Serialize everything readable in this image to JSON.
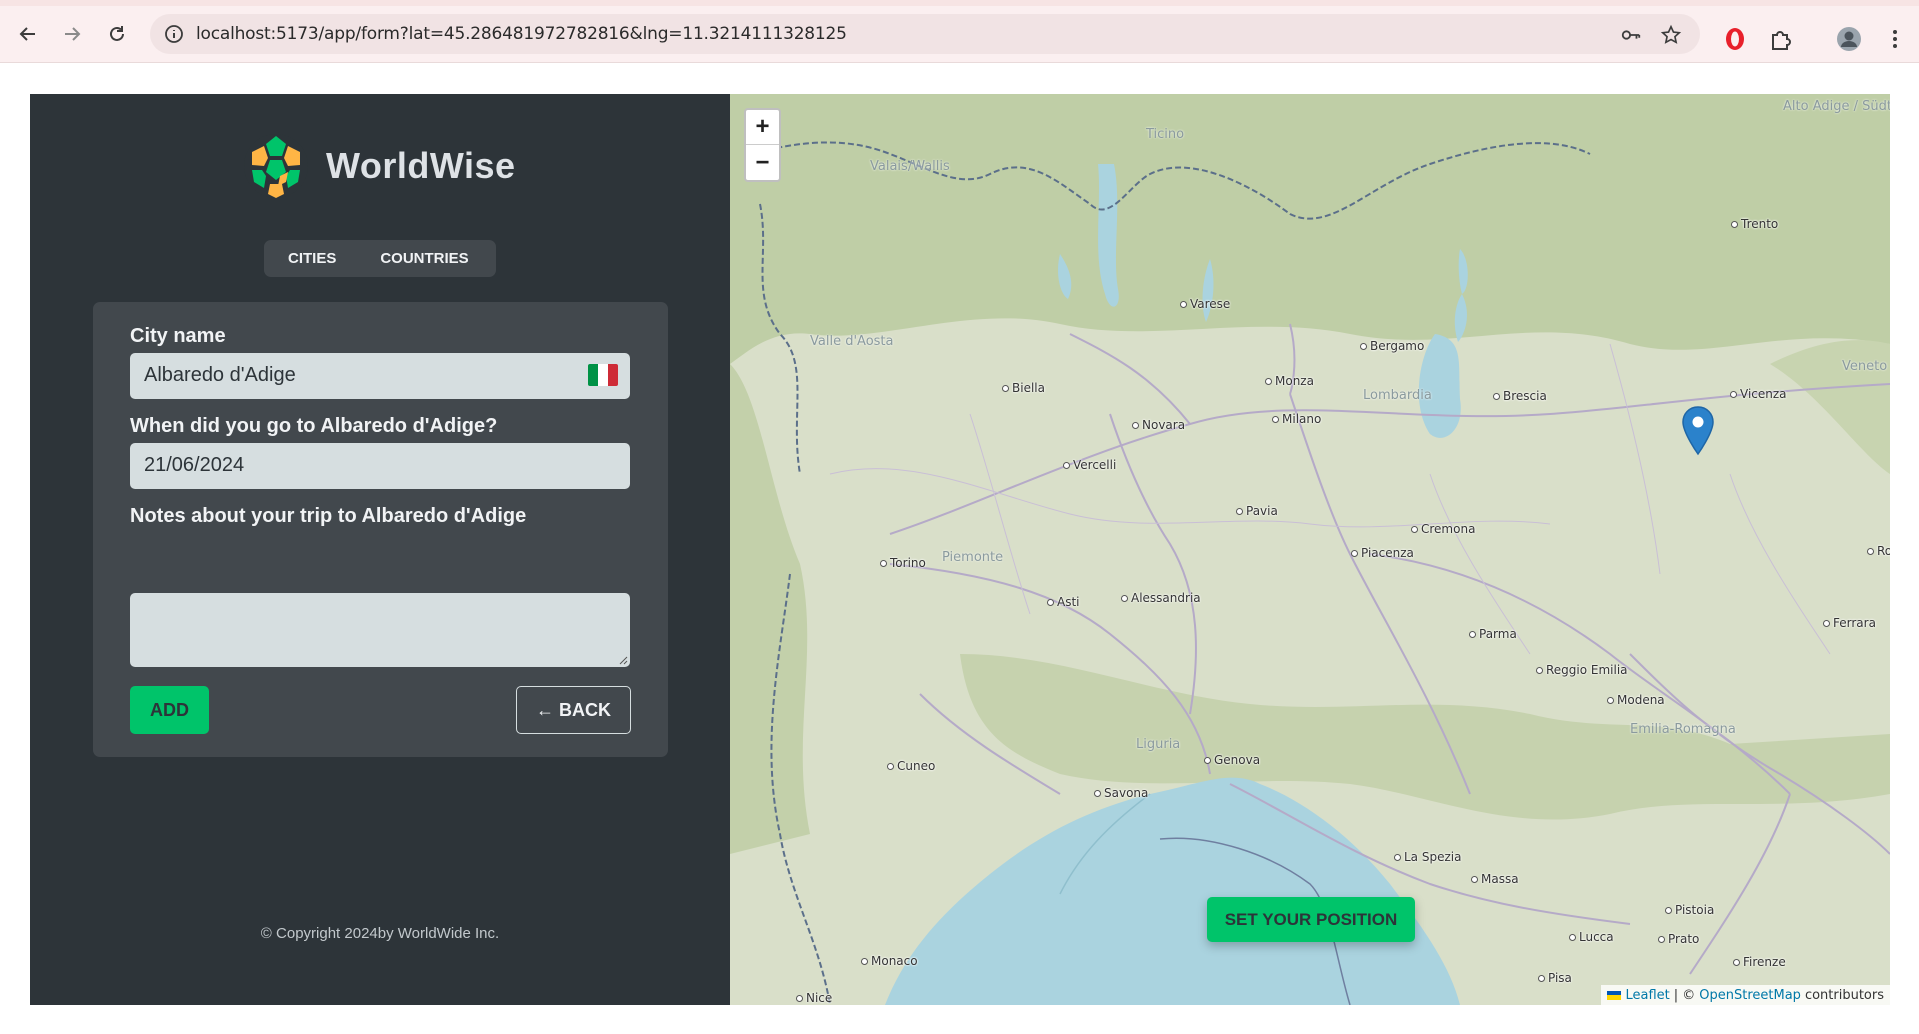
{
  "browser": {
    "url": "localhost:5173/app/form?lat=45.286481972782816&lng=11.3214111328125"
  },
  "sidebar": {
    "logo_text": "WorldWise",
    "tabs": [
      {
        "label": "CITIES"
      },
      {
        "label": "COUNTRIES"
      }
    ],
    "form": {
      "city_label": "City name",
      "city_value": "Albaredo d'Adige",
      "city_flag_colors": [
        "#009246",
        "#ffffff",
        "#ce2b37"
      ],
      "date_label": "When did you go to Albaredo d'Adige?",
      "date_value": "21/06/2024",
      "notes_label": "Notes about your trip to Albaredo d'Adige",
      "notes_value": "",
      "add_button": "ADD",
      "back_button": "← BACK"
    },
    "copyright": "© Copyright 2024by WorldWide Inc."
  },
  "map": {
    "zoom_in": "+",
    "zoom_out": "−",
    "set_position_button": "SET YOUR POSITION",
    "attribution": {
      "leaflet": "Leaflet",
      "separator": "| ©",
      "osm": "OpenStreetMap",
      "contributors": "contributors"
    },
    "places": [
      "Varese",
      "Bergamo",
      "Biella",
      "Monza",
      "Brescia",
      "Vicenza",
      "Trento",
      "Novara",
      "Milano",
      "Vercelli",
      "Pavia",
      "Cremona",
      "Piacenza",
      "Torino",
      "Asti",
      "Alessandria",
      "Parma",
      "Reggio Emilia",
      "Modena",
      "Ferrara",
      "Cuneo",
      "Genova",
      "Savona",
      "La Spezia",
      "Massa",
      "Pistoia",
      "Lucca",
      "Prato",
      "Firenze",
      "Pisa",
      "Monaco",
      "Nice",
      "Rovigo"
    ],
    "regions": [
      "Ticino",
      "Valais/Wallis",
      "Valle d'Aosta",
      "Lombardia",
      "Piemonte",
      "Liguria",
      "Emilia-Romagna",
      "Alto Adige / Südtirol",
      "Veneto"
    ],
    "colors": {
      "sea": "#aad3df",
      "land": "#d7ddc7",
      "forest": "#b6c79c",
      "road": "#b8aec8"
    }
  }
}
